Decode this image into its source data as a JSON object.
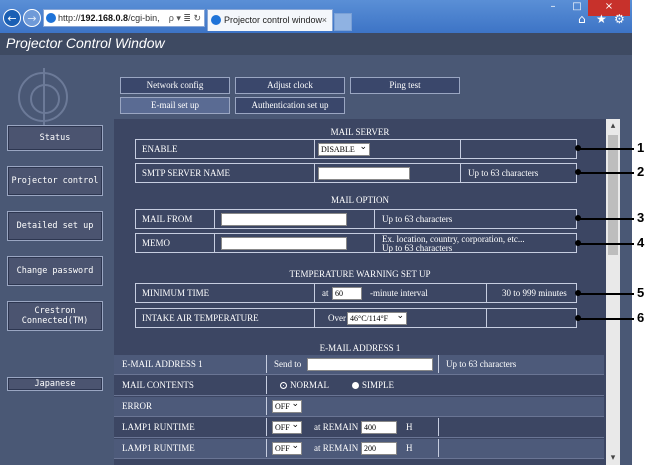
{
  "browser": {
    "address_prefix": "http://",
    "address_host": "192.168.0.8",
    "address_rest": "/cgi-bin,",
    "address_icons": "ρ ▾ ≣ ↻",
    "tab_title": "Projector control window",
    "tab_close": "×",
    "window_buttons": [
      "–",
      "□",
      "×"
    ],
    "toolbar_icons": [
      "⌂",
      "★",
      "⚙"
    ]
  },
  "app": {
    "title": "Projector Control Window"
  },
  "sidebar": {
    "items": [
      {
        "label": "Status"
      },
      {
        "label": "Projector control"
      },
      {
        "label": "Detailed set up"
      },
      {
        "label": "Change password"
      },
      {
        "label": "Crestron Connected(TM)"
      },
      {
        "label": "Japanese"
      }
    ]
  },
  "tabs": {
    "row1": [
      "Network config",
      "Adjust clock",
      "Ping test"
    ],
    "row2": [
      "E-mail set up",
      "Authentication set up"
    ],
    "active": "E-mail set up"
  },
  "mail_server": {
    "title": "MAIL SERVER",
    "enable_label": "ENABLE",
    "enable_value": "DISABLE",
    "smtp_label": "SMTP SERVER NAME",
    "smtp_value": "",
    "smtp_hint": "Up to 63 characters"
  },
  "mail_option": {
    "title": "MAIL OPTION",
    "from_label": "MAIL FROM",
    "from_value": "",
    "from_hint": "Up to 63 characters",
    "memo_label": "MEMO",
    "memo_value": "",
    "memo_hint_1": "Ex. location, country, corporation, etc...",
    "memo_hint_2": "Up to 63 characters"
  },
  "temperature": {
    "title": "TEMPERATURE WARNING SET UP",
    "min_time_label": "MINIMUM TIME",
    "at_label": "at",
    "min_time_value": "60",
    "interval_label": "-minute interval",
    "range_hint": "30 to 999 minutes",
    "intake_label": "INTAKE AIR TEMPERATURE",
    "over_label": "Over",
    "intake_value": "46°C/114°F"
  },
  "email_address_1": {
    "title": "E-MAIL ADDRESS 1",
    "address_label": "E-MAIL ADDRESS 1",
    "send_to_label": "Send to",
    "address_value": "",
    "address_hint": "Up to 63 characters",
    "contents_label": "MAIL CONTENTS",
    "contents_normal": "NORMAL",
    "contents_simple": "SIMPLE",
    "contents_selected": "NORMAL",
    "error_label": "ERROR",
    "error_value": "OFF",
    "lamp1_label": "LAMP1 RUNTIME",
    "lamp1_value": "OFF",
    "remain_label": "at REMAIN",
    "lamp1_remain": "400",
    "hours_unit": "H",
    "lamp1b_label": "LAMP1 RUNTIME",
    "lamp1b_value": "OFF",
    "lamp1b_remain": "200"
  },
  "scrollbar": {
    "up": "▴",
    "down": "▾"
  },
  "callouts": [
    "1",
    "2",
    "3",
    "4",
    "5",
    "6"
  ],
  "colors": {
    "chrome": "#3d74c6",
    "header": "#3e4a62",
    "panel": "#4a5875",
    "content": "#3c4663",
    "close": "#c7312b"
  }
}
